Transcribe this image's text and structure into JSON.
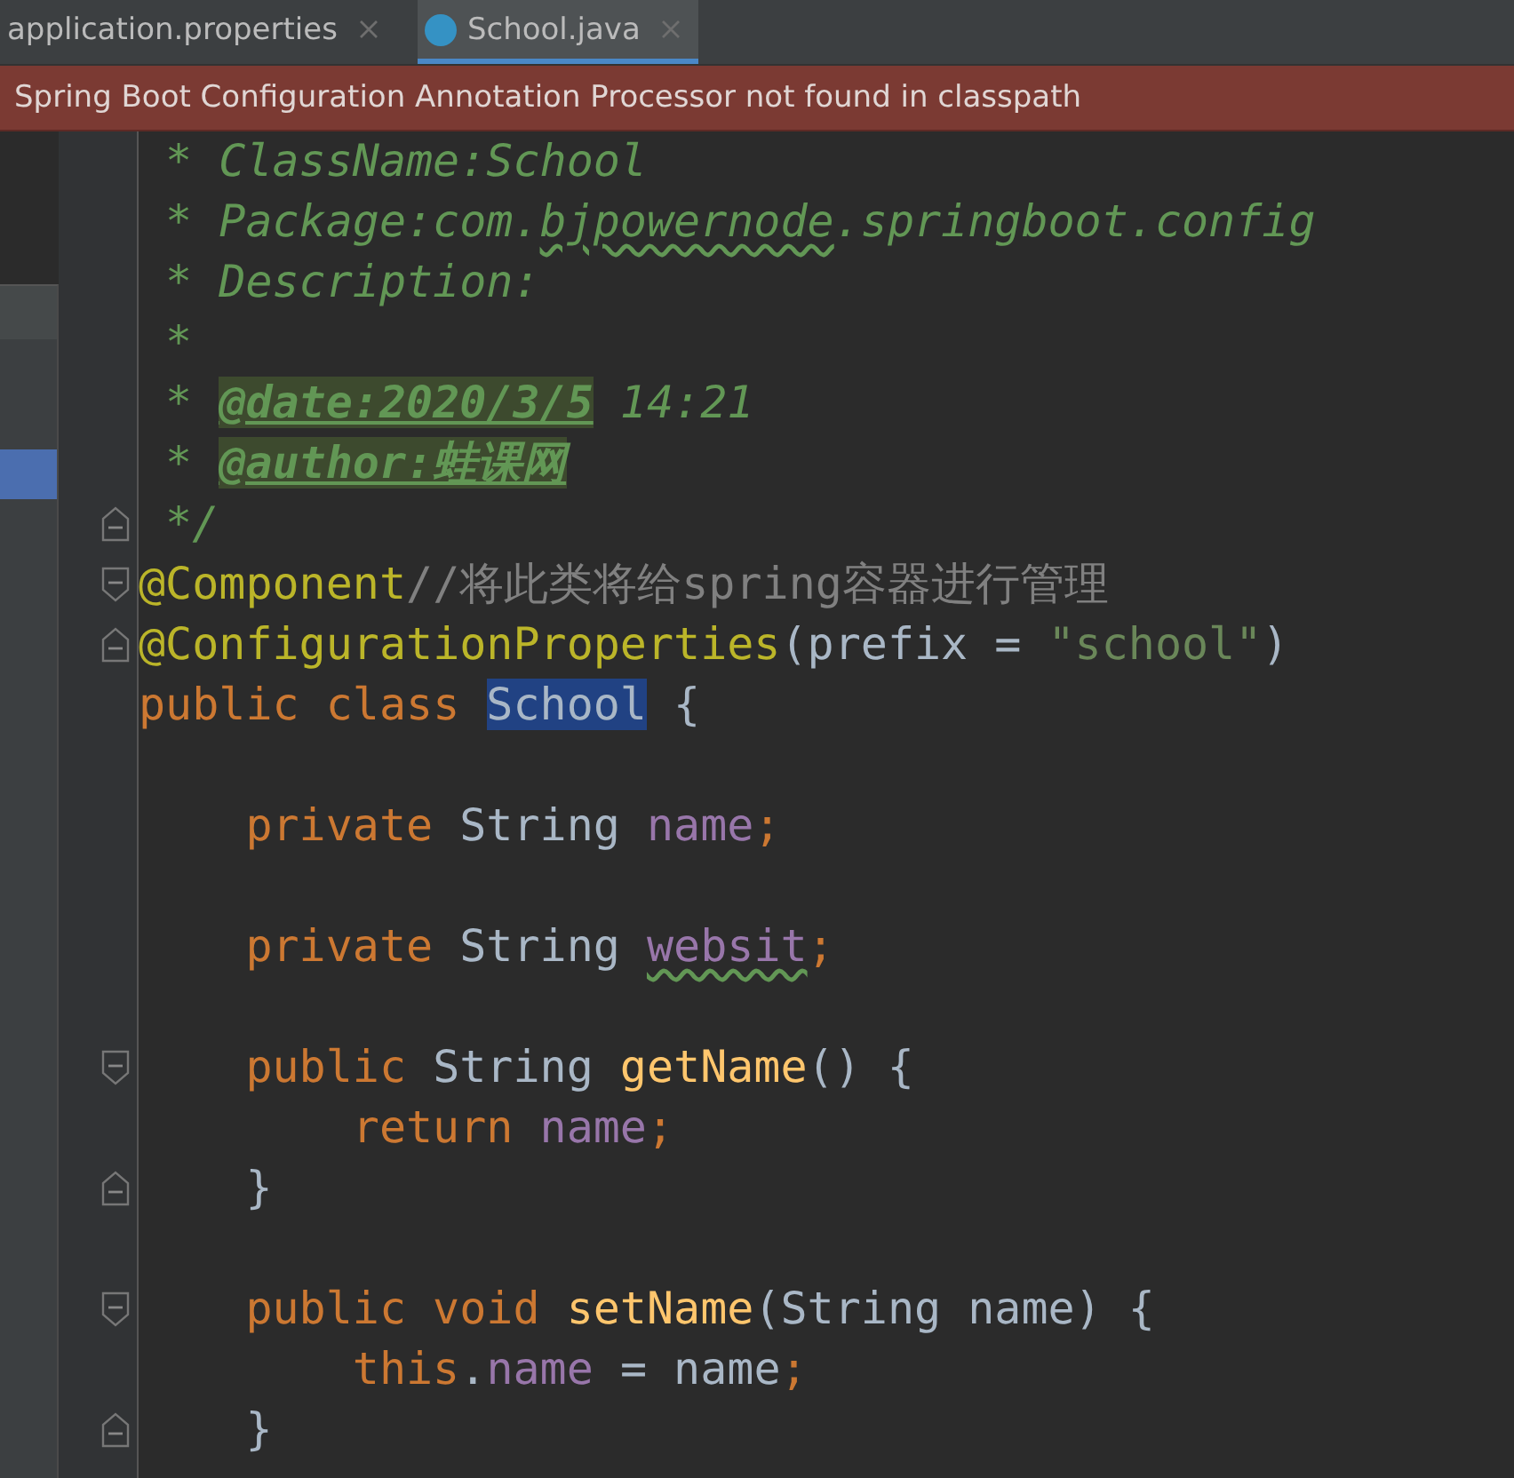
{
  "tabs": [
    {
      "label": "application.properties",
      "selected": false,
      "icon": false
    },
    {
      "label": "School.java",
      "selected": true,
      "icon": true
    }
  ],
  "banner": {
    "message": "Spring Boot Configuration Annotation Processor not found in classpath"
  },
  "code_lines": [
    {
      "kind": "doc",
      "tokens": [
        {
          "kind": "comment",
          "text": "* ClassName:School"
        }
      ]
    },
    {
      "kind": "doc",
      "tokens": [
        {
          "kind": "comment",
          "text": "* Package:com."
        },
        {
          "kind": "comment-typo",
          "text": "bjpowernode"
        },
        {
          "kind": "comment",
          "text": ".springboot.config"
        }
      ]
    },
    {
      "kind": "doc",
      "tokens": [
        {
          "kind": "comment",
          "text": "* Description:"
        }
      ]
    },
    {
      "kind": "doc",
      "tokens": [
        {
          "kind": "comment",
          "text": "*"
        }
      ]
    },
    {
      "kind": "doc",
      "tokens": [
        {
          "kind": "comment",
          "text": "* "
        },
        {
          "kind": "doc-tag",
          "text": "@date:2020/3/5"
        },
        {
          "kind": "comment",
          "text": " 14:21"
        }
      ]
    },
    {
      "kind": "doc",
      "tokens": [
        {
          "kind": "comment",
          "text": "* "
        },
        {
          "kind": "doc-tag",
          "text": "@author:蛙课网"
        }
      ]
    },
    {
      "kind": "doc",
      "fold_end": true,
      "tokens": [
        {
          "kind": "comment",
          "text": "*/"
        }
      ]
    },
    {
      "kind": "top",
      "fold_start": true,
      "tokens": [
        {
          "kind": "annotation",
          "text": "@Component"
        },
        {
          "kind": "line-comment",
          "text": "//将此类将给spring容器进行管理"
        }
      ]
    },
    {
      "kind": "top",
      "fold_end": true,
      "tokens": [
        {
          "kind": "annotation",
          "text": "@ConfigurationProperties"
        },
        {
          "kind": "plain",
          "text": "(prefix = "
        },
        {
          "kind": "string",
          "text": "\"school\""
        },
        {
          "kind": "plain",
          "text": ")"
        }
      ]
    },
    {
      "kind": "top",
      "tokens": [
        {
          "kind": "keyword",
          "text": "public class "
        },
        {
          "kind": "highlight",
          "text": "School"
        },
        {
          "kind": "plain",
          "text": " {"
        }
      ]
    },
    {
      "kind": "blank"
    },
    {
      "kind": "member",
      "tokens": [
        {
          "kind": "keyword",
          "text": "private "
        },
        {
          "kind": "plain",
          "text": "String "
        },
        {
          "kind": "field",
          "text": "name"
        },
        {
          "kind": "keyword",
          "text": ";"
        }
      ]
    },
    {
      "kind": "blank"
    },
    {
      "kind": "member",
      "tokens": [
        {
          "kind": "keyword",
          "text": "private "
        },
        {
          "kind": "plain",
          "text": "String "
        },
        {
          "kind": "field-typo",
          "text": "websit"
        },
        {
          "kind": "keyword",
          "text": ";"
        }
      ]
    },
    {
      "kind": "blank"
    },
    {
      "kind": "member",
      "fold_start": true,
      "tokens": [
        {
          "kind": "keyword",
          "text": "public "
        },
        {
          "kind": "plain",
          "text": "String "
        },
        {
          "kind": "method",
          "text": "getName"
        },
        {
          "kind": "plain",
          "text": "() {"
        }
      ]
    },
    {
      "kind": "body",
      "tokens": [
        {
          "kind": "keyword",
          "text": "return "
        },
        {
          "kind": "field",
          "text": "name"
        },
        {
          "kind": "keyword",
          "text": ";"
        }
      ]
    },
    {
      "kind": "member",
      "fold_end": true,
      "tokens": [
        {
          "kind": "plain",
          "text": "}"
        }
      ]
    },
    {
      "kind": "blank"
    },
    {
      "kind": "member",
      "fold_start": true,
      "tokens": [
        {
          "kind": "keyword",
          "text": "public void "
        },
        {
          "kind": "method",
          "text": "setName"
        },
        {
          "kind": "plain",
          "text": "(String name) {"
        }
      ]
    },
    {
      "kind": "body",
      "tokens": [
        {
          "kind": "keyword",
          "text": "this"
        },
        {
          "kind": "plain",
          "text": "."
        },
        {
          "kind": "field",
          "text": "name"
        },
        {
          "kind": "plain",
          "text": " = name"
        },
        {
          "kind": "keyword",
          "text": ";"
        }
      ]
    },
    {
      "kind": "member",
      "fold_end": true,
      "tokens": [
        {
          "kind": "plain",
          "text": "}"
        }
      ]
    }
  ]
}
